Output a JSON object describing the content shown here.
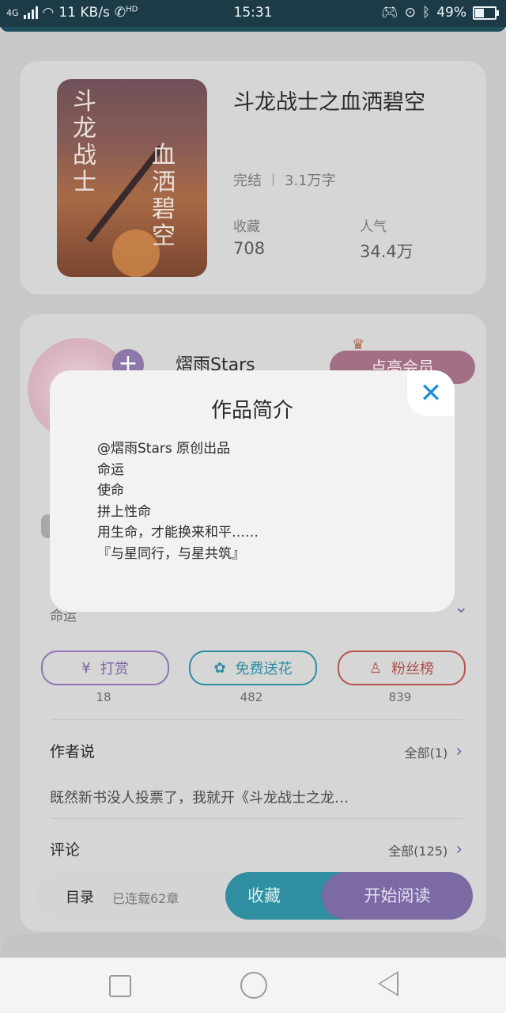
{
  "status_bar": {
    "network": "4G",
    "speed": "11 KB/s",
    "hd": "HD",
    "time": "15:31",
    "battery_pct": "49%",
    "battery_level": 0.49
  },
  "book": {
    "title": "斗龙战士之血洒碧空",
    "status": "完结",
    "word_count": "3.1万字",
    "favorites_label": "收藏",
    "favorites_value": "708",
    "popularity_label": "人气",
    "popularity_value": "34.4万",
    "cover_text_1": "斗龙战士",
    "cover_text_2": "血洒碧空"
  },
  "author": {
    "name": "熠雨Stars",
    "follow_symbol": "+",
    "vip_label": "点亮会员",
    "tag_text": "命运"
  },
  "actions": {
    "tip": {
      "label": "打赏",
      "count": "18",
      "icon": "yen-coin-icon"
    },
    "flower": {
      "label": "免费送花",
      "count": "482",
      "icon": "flower-icon"
    },
    "fans": {
      "label": "粉丝榜",
      "count": "839",
      "icon": "fan-user-icon"
    }
  },
  "author_says": {
    "title": "作者说",
    "all_label": "全部(1)",
    "preview": "既然新书没人投票了，我就开《斗龙战士之龙…"
  },
  "comments": {
    "title": "评论",
    "all_label": "全部(125)"
  },
  "bottom_bar": {
    "catalog_label": "目录",
    "chapters_label": "已连载62章",
    "collect_label": "收藏",
    "read_label": "开始阅读"
  },
  "modal": {
    "title": "作品简介",
    "close_icon": "close-icon",
    "lines": [
      "@熠雨Stars 原创出品",
      "命运",
      "使命",
      "拼上性命",
      "用生命，才能换来和平……",
      "『与星同行，与星共筑』"
    ]
  },
  "colors": {
    "accent_blue": "#1e8fd6",
    "collect_teal": "#2f8ea0",
    "read_purple": "#7b6aa3"
  }
}
